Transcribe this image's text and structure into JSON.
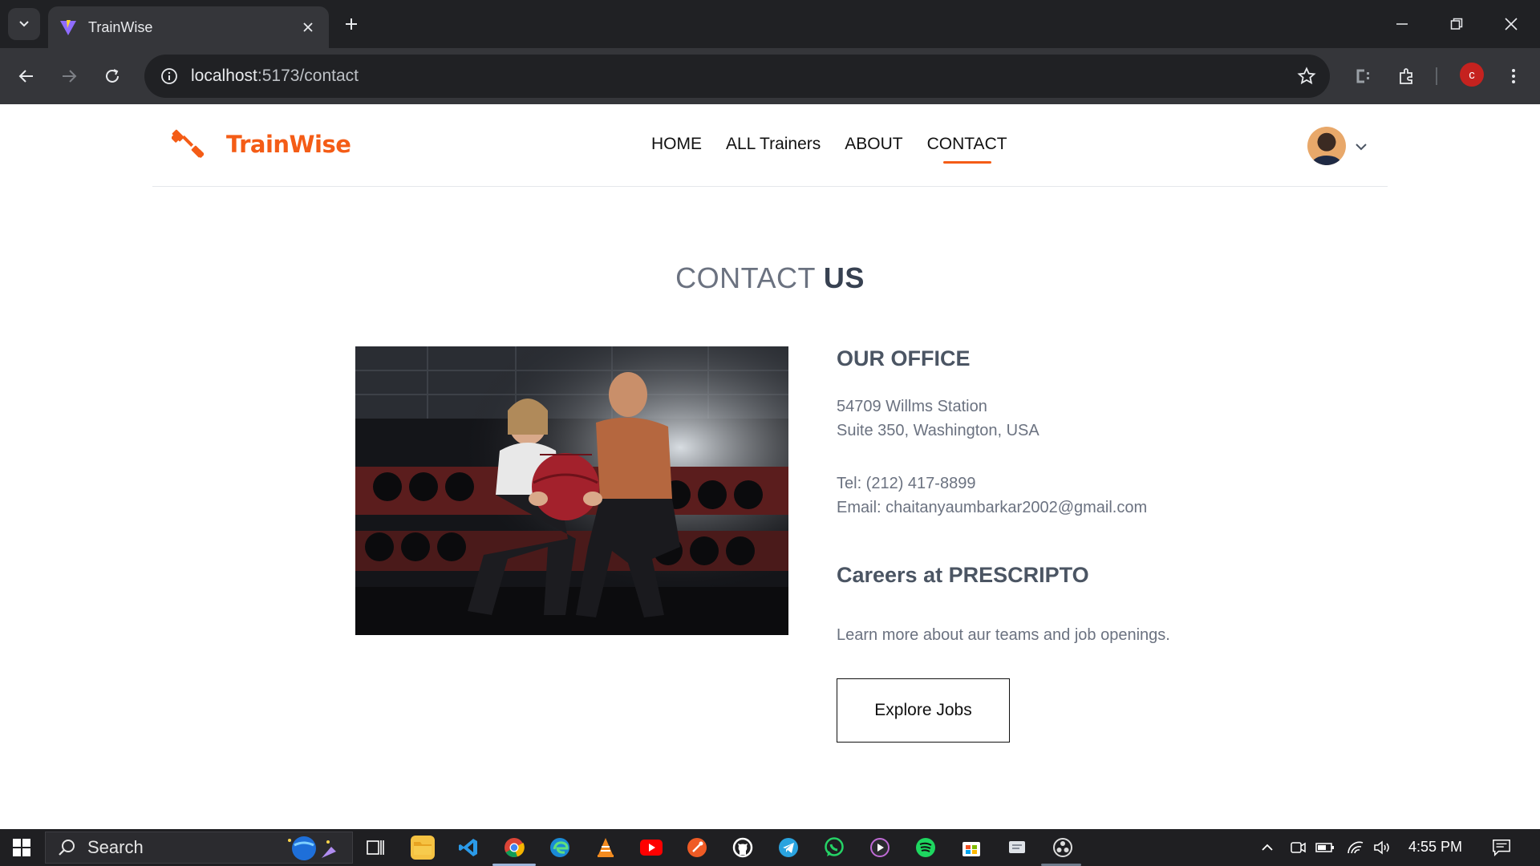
{
  "browser": {
    "tab_title": "TrainWise",
    "url_host": "localhost",
    "url_path": ":5173/contact"
  },
  "site": {
    "brand": "TrainWise",
    "nav": [
      {
        "label": "HOME"
      },
      {
        "label": "ALL Trainers"
      },
      {
        "label": "ABOUT"
      },
      {
        "label": "CONTACT",
        "active": true
      }
    ]
  },
  "contact": {
    "heading_light": "CONTACT",
    "heading_bold": "US",
    "office_title": "OUR OFFICE",
    "address_line1": "54709 Willms Station",
    "address_line2": "Suite 350, Washington, USA",
    "tel": "Tel: (212) 417-8899",
    "email": "Email: chaitanyaumbarkar2002@gmail.com",
    "careers_title": "Careers at PRESCRIPTO",
    "careers_text": "Learn more about aur teams and job openings.",
    "jobs_button": "Explore Jobs"
  },
  "taskbar": {
    "search_placeholder": "Search",
    "time": "4:55 PM"
  },
  "colors": {
    "brand_orange": "#f45c16",
    "chrome_dark": "#202124",
    "chrome_toolbar": "#35363a"
  }
}
